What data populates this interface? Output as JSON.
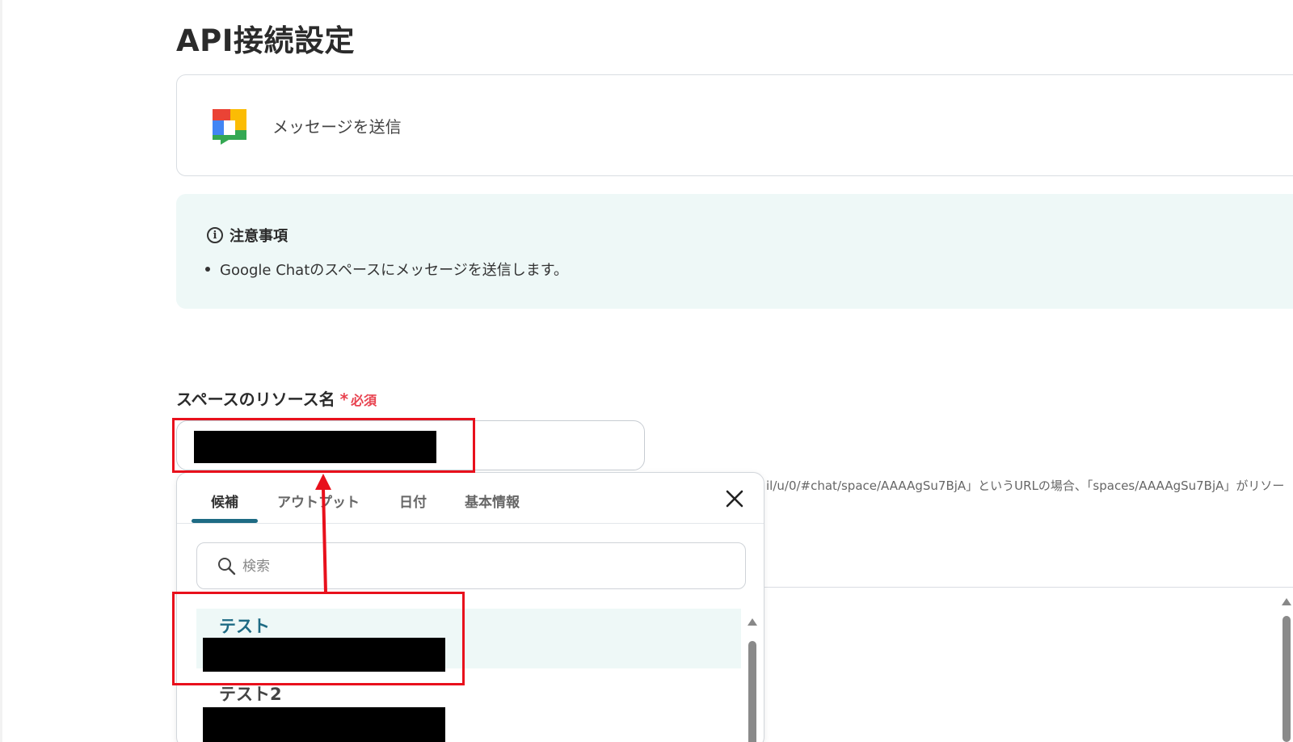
{
  "page": {
    "title": "API接続設定"
  },
  "action_card": {
    "label": "メッセージを送信",
    "icon": "google-chat-icon"
  },
  "notice": {
    "title": "注意事項",
    "items": [
      "Google Chatのスペースにメッセージを送信します。"
    ]
  },
  "field": {
    "label": "スペースのリソース名",
    "required_mark": "*",
    "required_text": "必須",
    "hint": "il/u/0/#chat/space/AAAAgSu7BjA」というURLの場合、「spaces/AAAAgSu7BjA」がリソー"
  },
  "dropdown": {
    "tabs": [
      {
        "label": "候補",
        "active": true
      },
      {
        "label": "アウトプット",
        "active": false
      },
      {
        "label": "日付",
        "active": false
      },
      {
        "label": "基本情報",
        "active": false
      }
    ],
    "search_placeholder": "検索",
    "options": [
      {
        "label": "テスト",
        "highlighted": true,
        "color": "#1e6b84"
      },
      {
        "label": "テスト2",
        "highlighted": false,
        "color": "#444444"
      }
    ]
  },
  "colors": {
    "accent": "#1e6b84",
    "required": "#e8424f",
    "annotation": "#e8101c",
    "notice_bg": "#eef8f7"
  }
}
